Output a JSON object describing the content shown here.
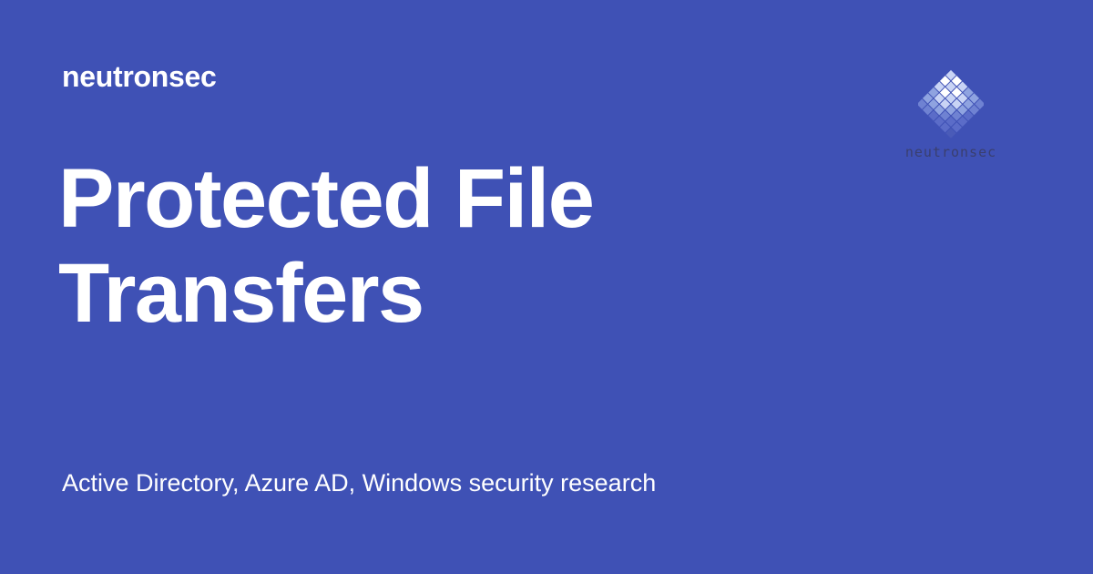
{
  "site": {
    "name": "neutronsec"
  },
  "post": {
    "title": "Protected File Transfers",
    "tagline": "Active Directory, Azure AD, Windows security research"
  },
  "logo": {
    "icon": "diamond-grid-icon",
    "wordmark": "neutronsec"
  },
  "colors": {
    "background": "#3f51b5",
    "text": "#ffffff",
    "logo_dark": "#5b6cc8",
    "logo_mid": "#8fa3e0",
    "logo_light": "#c9d4f5",
    "logo_white": "#ffffff"
  }
}
